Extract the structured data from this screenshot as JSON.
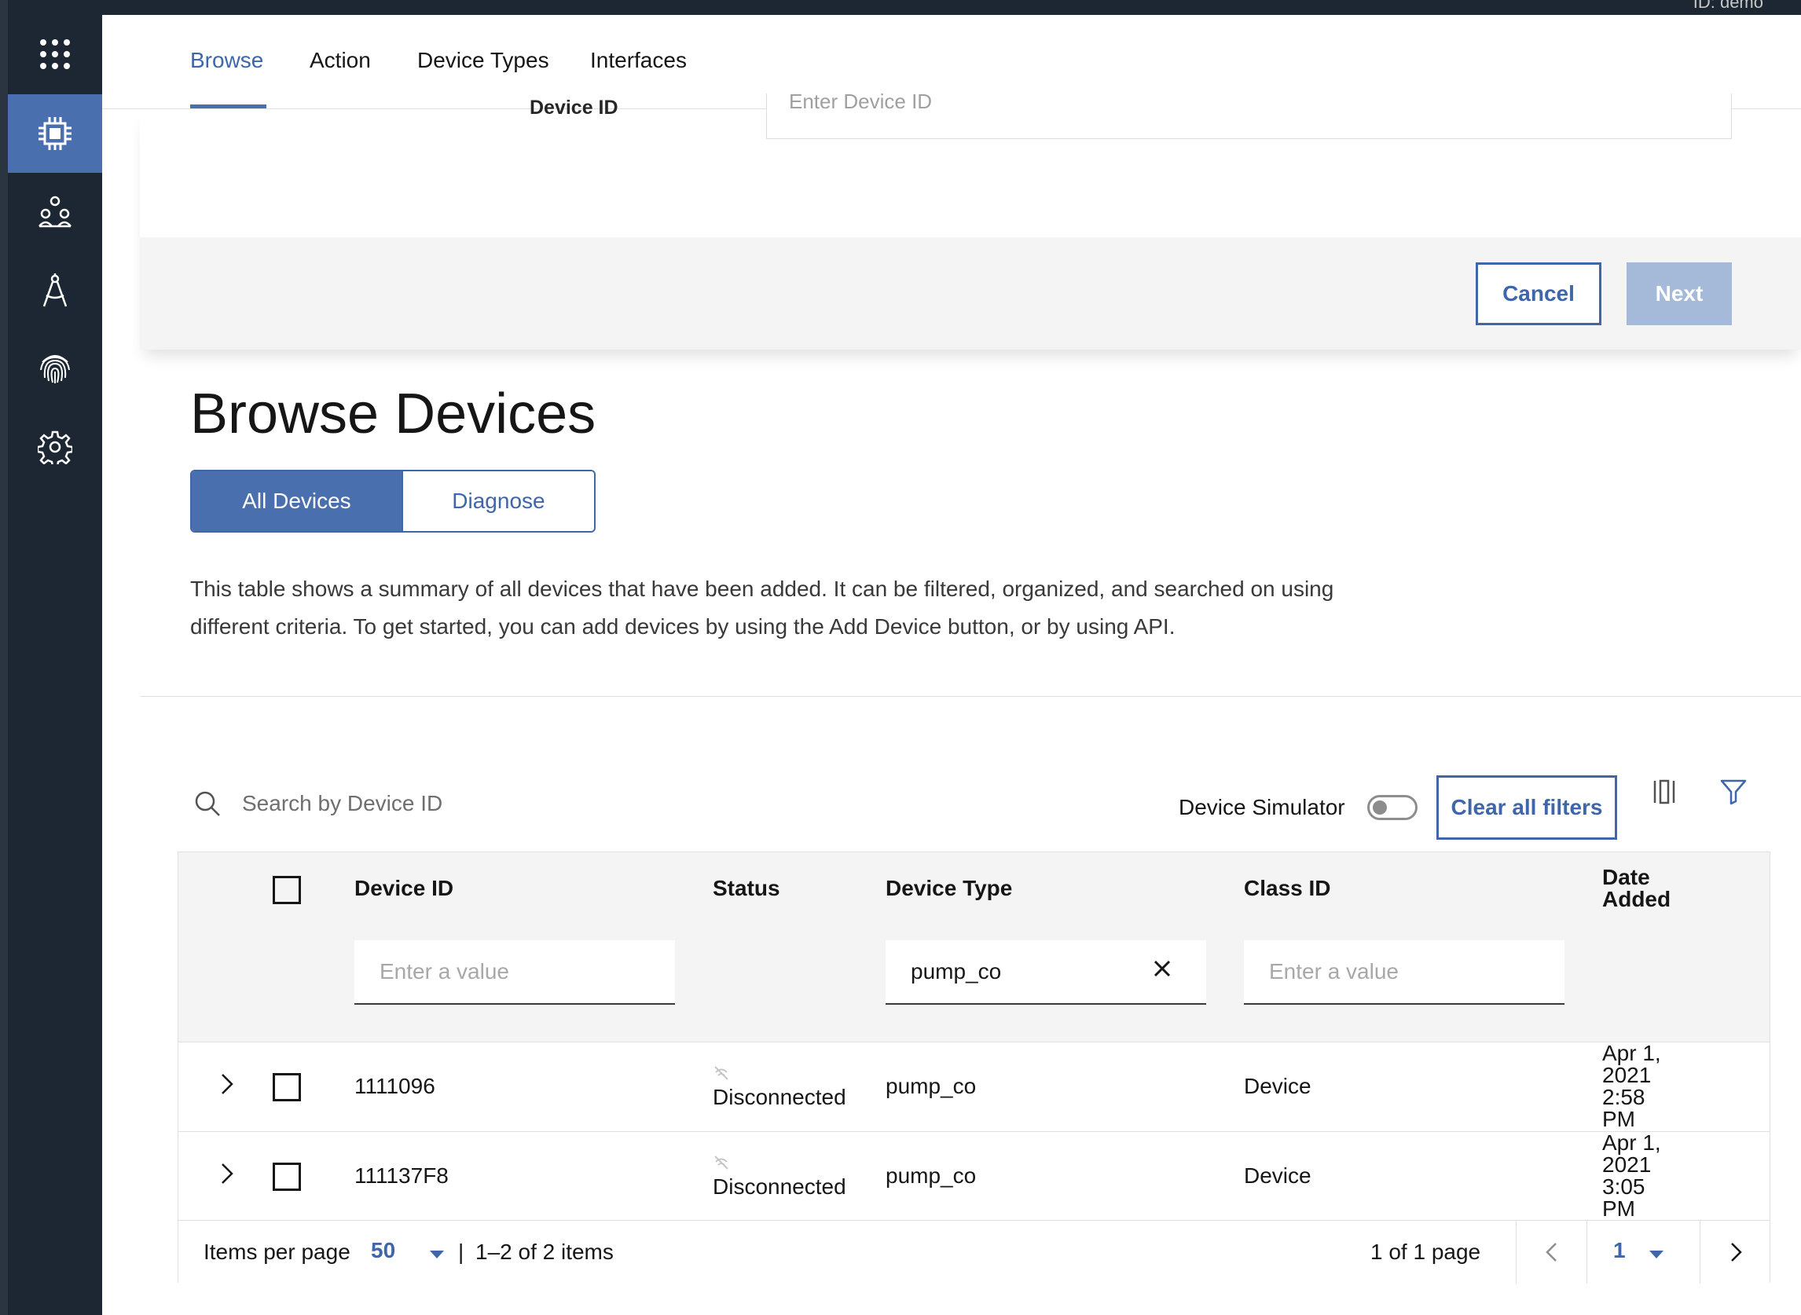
{
  "account": {
    "label": "ID: demo"
  },
  "tabs": [
    {
      "label": "Browse",
      "active": true
    },
    {
      "label": "Action",
      "active": false
    },
    {
      "label": "Device Types",
      "active": false
    },
    {
      "label": "Interfaces",
      "active": false
    }
  ],
  "sidebar": {
    "items": [
      {
        "icon": "app-switcher-icon"
      },
      {
        "icon": "chip-icon",
        "active": true
      },
      {
        "icon": "members-icon"
      },
      {
        "icon": "compass-icon"
      },
      {
        "icon": "fingerprint-icon"
      },
      {
        "icon": "settings-gear-icon"
      }
    ]
  },
  "add_panel": {
    "device_id_label": "Device ID",
    "device_id_placeholder": "Enter Device ID",
    "cancel_label": "Cancel",
    "next_label": "Next"
  },
  "page": {
    "title": "Browse Devices",
    "segments": [
      "All Devices",
      "Diagnose"
    ],
    "description": "This table shows a summary of all devices that have been added. It can be filtered, organized, and searched on using different criteria. To get started, you can add devices by using the Add Device button, or by using API."
  },
  "toolbar": {
    "search_placeholder": "Search by Device ID",
    "simulator_label": "Device Simulator",
    "clear_filters_label": "Clear all filters"
  },
  "table": {
    "columns": {
      "device_id": "Device ID",
      "status": "Status",
      "device_type": "Device Type",
      "class_id": "Class ID",
      "date_added_1": "Date",
      "date_added_2": "Added"
    },
    "filters": {
      "device_id_placeholder": "Enter a value",
      "device_type_value": "pump_co",
      "class_id_placeholder": "Enter a value"
    },
    "rows": [
      {
        "device_id": "1111096",
        "status": "Disconnected",
        "device_type": "pump_co",
        "class_id": "Device",
        "date": [
          "Apr 1,",
          "2021",
          "2:58",
          "PM"
        ]
      },
      {
        "device_id": "111137F8",
        "status": "Disconnected",
        "device_type": "pump_co",
        "class_id": "Device",
        "date": [
          "Apr 1,",
          "2021",
          "3:05",
          "PM"
        ]
      }
    ]
  },
  "pagination": {
    "items_per_page_label": "Items per page",
    "items_per_page_value": "50",
    "range_label": "1–2 of 2 items",
    "separator": "|",
    "page_of_label": "1 of 1 page",
    "current_page": "1"
  },
  "colors": {
    "accent": "#3e66a8",
    "sidebar_bg": "#1c2733",
    "active_item": "#4a6fae"
  }
}
